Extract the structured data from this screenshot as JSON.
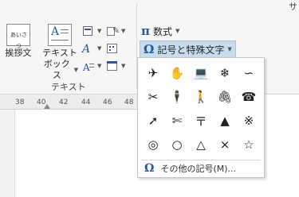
{
  "window": {
    "title_fragment": "サ"
  },
  "ribbon": {
    "greeting_button": {
      "icon_text": "あいさつ",
      "label": "挨拶文"
    },
    "textbox_button": {
      "label_line1": "テキスト",
      "label_line2": "ボックス"
    },
    "group_label": "テキスト",
    "equation_button": {
      "icon": "π",
      "label": "数式"
    },
    "symbol_button": {
      "icon": "Ω",
      "label": "記号と特殊文字"
    }
  },
  "ruler": {
    "ticks": [
      "38",
      "40",
      "42",
      "44",
      "46",
      "48"
    ]
  },
  "symbol_popup": {
    "symbols": [
      {
        "char": "✈",
        "name": "airplane-symbol"
      },
      {
        "char": "✋",
        "name": "hand-symbol"
      },
      {
        "char": "💻",
        "name": "computer-symbol"
      },
      {
        "char": "❄",
        "name": "snowflake-symbol"
      },
      {
        "char": "∽",
        "name": "glasses-symbol"
      },
      {
        "char": "✂",
        "name": "scissors-symbol"
      },
      {
        "char": "🕴",
        "name": "man-symbol"
      },
      {
        "char": "🚶",
        "name": "woman-symbol"
      },
      {
        "char": "🖇",
        "name": "paperclip-symbol"
      },
      {
        "char": "☎",
        "name": "telephone-symbol"
      },
      {
        "char": "➚",
        "name": "arrow-up-right-symbol"
      },
      {
        "char": "✄",
        "name": "scissors-small-symbol"
      },
      {
        "char": "〒",
        "name": "postal-mark-symbol"
      },
      {
        "char": "▲",
        "name": "black-triangle-symbol"
      },
      {
        "char": "※",
        "name": "reference-mark-symbol"
      },
      {
        "char": "◎",
        "name": "double-circle-symbol"
      },
      {
        "char": "○",
        "name": "white-circle-symbol"
      },
      {
        "char": "△",
        "name": "white-triangle-symbol"
      },
      {
        "char": "×",
        "name": "multiplication-symbol"
      },
      {
        "char": "☆",
        "name": "white-star-symbol"
      }
    ],
    "more_icon": "Ω",
    "more_label": "その他の記号(M)..."
  },
  "colors": {
    "accent": "#2b579a",
    "highlight": "#c6dcef"
  }
}
